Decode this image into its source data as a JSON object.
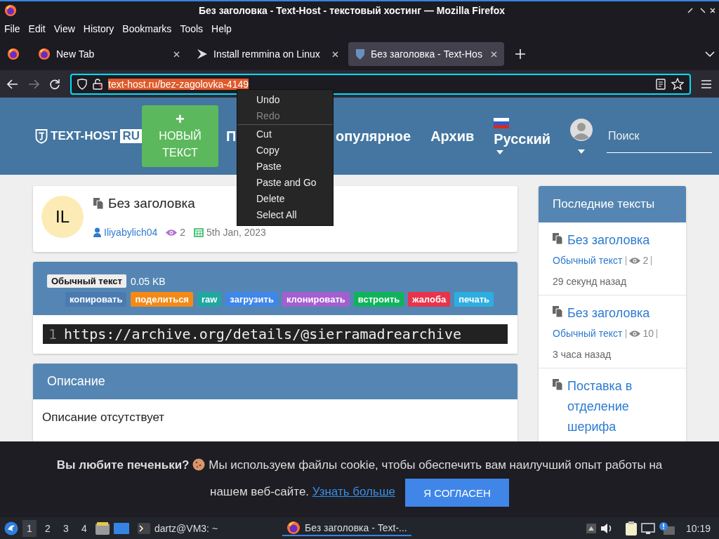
{
  "window": {
    "title": "Без заголовка - Text-Host - текстовый хостинг — Mozilla Firefox"
  },
  "menubar": [
    "File",
    "Edit",
    "View",
    "History",
    "Bookmarks",
    "Tools",
    "Help"
  ],
  "tabs": [
    {
      "label": "New Tab",
      "kind": "firefox",
      "selected": false
    },
    {
      "label": "Install remmina on Linux",
      "kind": "arrow",
      "selected": false
    },
    {
      "label": "Без заголовка - Text-Hos",
      "kind": "shield",
      "selected": true
    }
  ],
  "address": {
    "url": "text-host.ru/bez-zagolovka-4149"
  },
  "context_menu": [
    {
      "label": "Undo",
      "disabled": false,
      "separator_after": false
    },
    {
      "label": "Redo",
      "disabled": true,
      "separator_after": true
    },
    {
      "label": "Cut",
      "disabled": false,
      "separator_after": false
    },
    {
      "label": "Copy",
      "disabled": false,
      "separator_after": false
    },
    {
      "label": "Paste",
      "disabled": false,
      "separator_after": false
    },
    {
      "label": "Paste and Go",
      "disabled": false,
      "separator_after": false
    },
    {
      "label": "Delete",
      "disabled": false,
      "separator_after": false
    },
    {
      "label": "Select All",
      "disabled": false,
      "separator_after": false
    }
  ],
  "header": {
    "logo": "TEXT-HOST",
    "logo_badge": "RU",
    "new_button": {
      "plus": "+",
      "label": "НОВЫЙ ТЕКСТ"
    },
    "nav": [
      "П",
      "опулярное",
      "Архив"
    ],
    "language": "Русский",
    "search_placeholder": "Поиск"
  },
  "paste": {
    "avatar": "IL",
    "title": "Без заголовка",
    "author": "Iliyabylich04",
    "views": "2",
    "date": "5th Jan, 2023"
  },
  "toolbar": {
    "type": "Обычный текст",
    "size": "0.05 KB",
    "actions": [
      {
        "label": "копировать",
        "color": "#4a7bb0"
      },
      {
        "label": "поделиться",
        "color": "#f48a16"
      },
      {
        "label": "raw",
        "color": "#20a8a0"
      },
      {
        "label": "загрузить",
        "color": "#3f86e8"
      },
      {
        "label": "клонировать",
        "color": "#a35fd0"
      },
      {
        "label": "встроить",
        "color": "#0fb45a"
      },
      {
        "label": "жалоба",
        "color": "#e8344a"
      },
      {
        "label": "печать",
        "color": "#2eaee0"
      }
    ]
  },
  "code": {
    "line": "1",
    "text": "https://archive.org/details/@sierramadrearchive"
  },
  "description": {
    "heading": "Описание",
    "text": "Описание отсутствует"
  },
  "sidebar": {
    "heading": "Последние тексты",
    "items": [
      {
        "title": "Без заголовка",
        "type": "Обычный текст",
        "views": "2",
        "age": "29 секунд назад"
      },
      {
        "title": "Без заголовка",
        "type": "Обычный текст",
        "views": "10",
        "age": "3 часа назад"
      },
      {
        "title": "Поставка в отделение шерифа"
      }
    ]
  },
  "cookie": {
    "text": "**Вы любите печеньки?** ",
    "text2": "Мы используем файлы cookie, чтобы обеспечить вам наилучший опыт работы на нашем веб-сайте.",
    "link": "Узнать больше",
    "button": "Я СОГЛАСЕН"
  },
  "taskbar": {
    "workspaces": [
      {
        "label": "1",
        "selected": true
      },
      {
        "label": "2",
        "selected": false
      },
      {
        "label": "3",
        "selected": false
      },
      {
        "label": "4",
        "selected": false
      }
    ],
    "apps": [
      {
        "label": "dartz@VM3: ~",
        "kind": "terminal",
        "selected": false
      },
      {
        "label": "Без заголовка - Text-...",
        "kind": "firefox",
        "selected": true
      }
    ],
    "clock": "10:19"
  }
}
